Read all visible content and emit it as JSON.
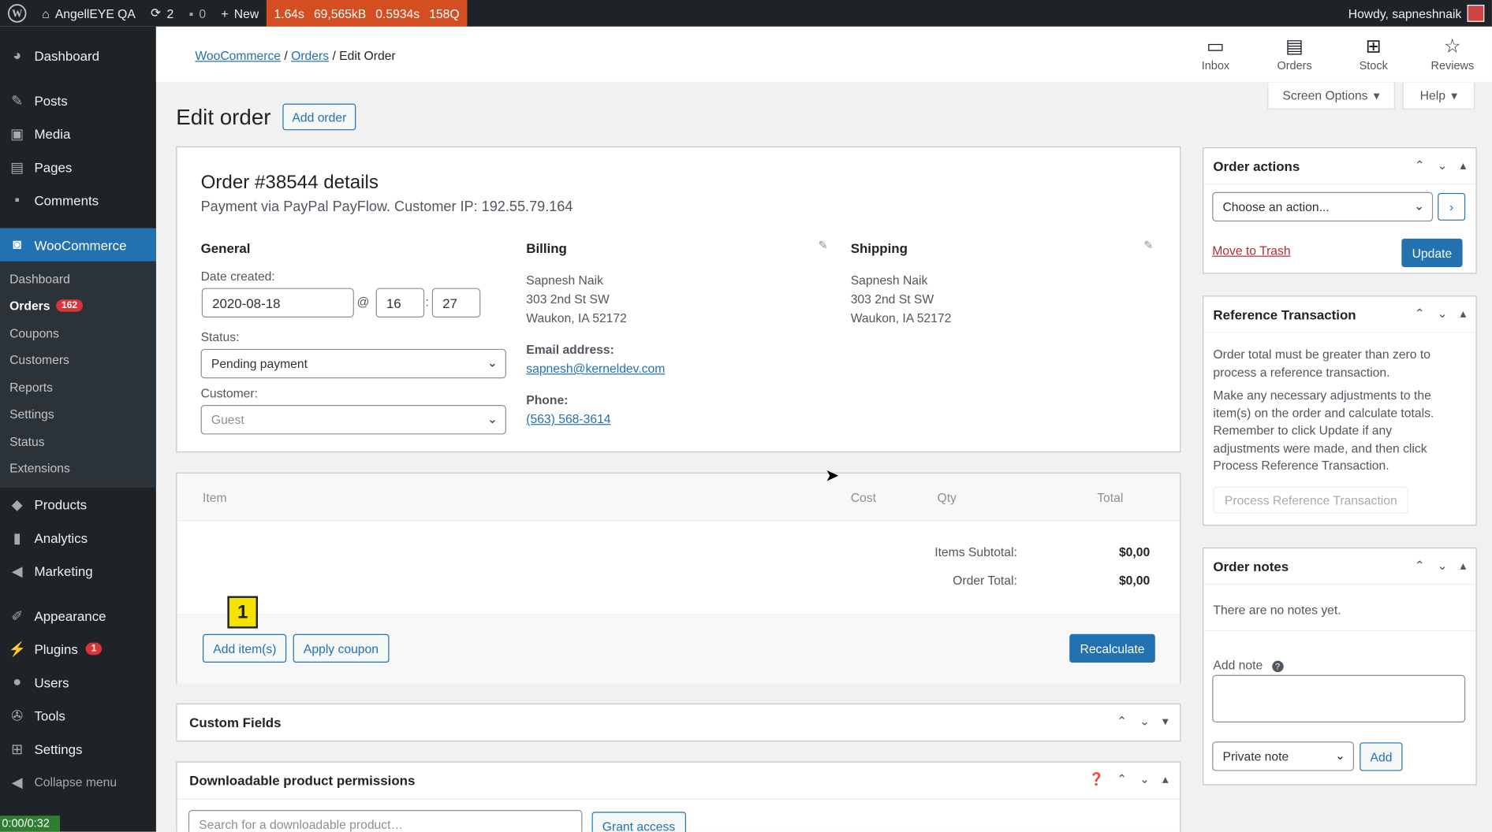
{
  "adminbar": {
    "site_name": "AngellEYE QA",
    "updates_count": "2",
    "comments_count": "0",
    "new_label": "New",
    "perf": [
      "1.64s",
      "69,565kB",
      "0.5934s",
      "158Q"
    ],
    "howdy": "Howdy, sapneshnaik"
  },
  "sidebar": {
    "dashboard": "Dashboard",
    "posts": "Posts",
    "media": "Media",
    "pages": "Pages",
    "comments": "Comments",
    "woocommerce": "WooCommerce",
    "sub": [
      "Dashboard",
      "Orders",
      "Coupons",
      "Customers",
      "Reports",
      "Settings",
      "Status",
      "Extensions"
    ],
    "orders_badge": "162",
    "products": "Products",
    "analytics": "Analytics",
    "marketing": "Marketing",
    "appearance": "Appearance",
    "plugins": "Plugins",
    "plugins_badge": "1",
    "users": "Users",
    "tools": "Tools",
    "settings": "Settings",
    "collapse": "Collapse menu",
    "timer": "0:00/0:32"
  },
  "header": {
    "breadcrumb": [
      "WooCommerce",
      "Orders",
      "Edit Order"
    ],
    "icons": [
      "Inbox",
      "Orders",
      "Stock",
      "Reviews"
    ],
    "screen_options": "Screen Options",
    "help": "Help"
  },
  "page": {
    "title": "Edit order",
    "add_order": "Add order"
  },
  "order": {
    "title": "Order #38544 details",
    "subtitle": "Payment via PayPal PayFlow. Customer IP: 192.55.79.164",
    "general_h": "General",
    "date_created_lbl": "Date created:",
    "date": "2020-08-18",
    "hour": "16",
    "minute": "27",
    "status_lbl": "Status:",
    "status": "Pending payment",
    "customer_lbl": "Customer:",
    "customer": "Guest",
    "billing_h": "Billing",
    "billing_name": "Sapnesh Naik",
    "billing_street": "303 2nd St SW",
    "billing_city": "Waukon, IA 52172",
    "email_lbl": "Email address:",
    "email": "sapnesh@kerneldev.com",
    "phone_lbl": "Phone:",
    "phone": "(563) 568-3614",
    "shipping_h": "Shipping",
    "shipping_name": "Sapnesh Naik",
    "shipping_street": "303 2nd St SW",
    "shipping_city": "Waukon, IA 52172"
  },
  "items": {
    "col_item": "Item",
    "col_cost": "Cost",
    "col_qty": "Qty",
    "col_total": "Total",
    "subtotal_lbl": "Items Subtotal:",
    "subtotal": "$0,00",
    "total_lbl": "Order Total:",
    "total": "$0,00",
    "add_items": "Add item(s)",
    "apply_coupon": "Apply coupon",
    "recalculate": "Recalculate",
    "callout": "1"
  },
  "custom_fields": "Custom Fields",
  "downloads": {
    "title": "Downloadable product permissions",
    "search_placeholder": "Search for a downloadable product…",
    "grant": "Grant access"
  },
  "actions": {
    "title": "Order actions",
    "choose": "Choose an action...",
    "trash": "Move to Trash",
    "update": "Update"
  },
  "reference": {
    "title": "Reference Transaction",
    "p1": "Order total must be greater than zero to process a reference transaction.",
    "p2": "Make any necessary adjustments to the item(s) on the order and calculate totals. Remember to click Update if any adjustments were made, and then click Process Reference Transaction.",
    "button": "Process Reference Transaction"
  },
  "notes": {
    "title": "Order notes",
    "empty": "There are no notes yet.",
    "add_note_lbl": "Add note",
    "type": "Private note",
    "add": "Add"
  }
}
